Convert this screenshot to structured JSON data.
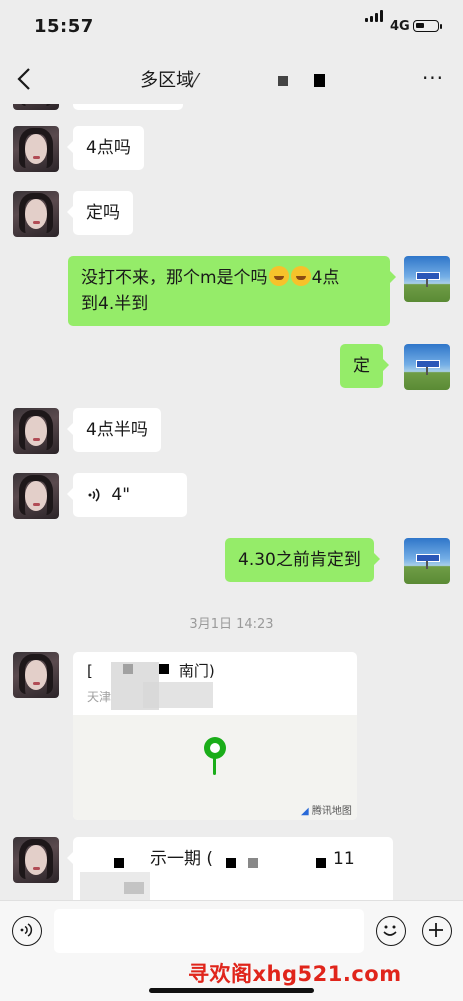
{
  "status_bar": {
    "time": "15:57",
    "network": "4G"
  },
  "nav": {
    "title": "多区域",
    "title_obscured_suffix": "⁄ ",
    "more_label": "···"
  },
  "messages": [
    {
      "side": "left",
      "text": "4点吗"
    },
    {
      "side": "left",
      "text": "定吗"
    },
    {
      "side": "right",
      "text_a": "没打不来，那个m是个吗",
      "text_b": "4点",
      "text_c": "到4.半到"
    },
    {
      "side": "right",
      "text": "定"
    },
    {
      "side": "left",
      "text": "4点半吗"
    },
    {
      "side": "left",
      "voice_duration": "4\""
    },
    {
      "side": "right",
      "text": "4.30之前肯定到"
    }
  ],
  "timestamp": "3月1日 14:23",
  "location_card": {
    "name_visible": "南门)",
    "addr_visible": "天津",
    "map_credit": "腾讯地图"
  },
  "last_message": {
    "text_visible": "示一期 (",
    "trailing": "11"
  },
  "watermark": "寻欢阁xhg521.com",
  "colors": {
    "right_bubble": "#95ec69",
    "left_bubble": "#ffffff",
    "background": "#ededed",
    "pin": "#1aad19"
  }
}
